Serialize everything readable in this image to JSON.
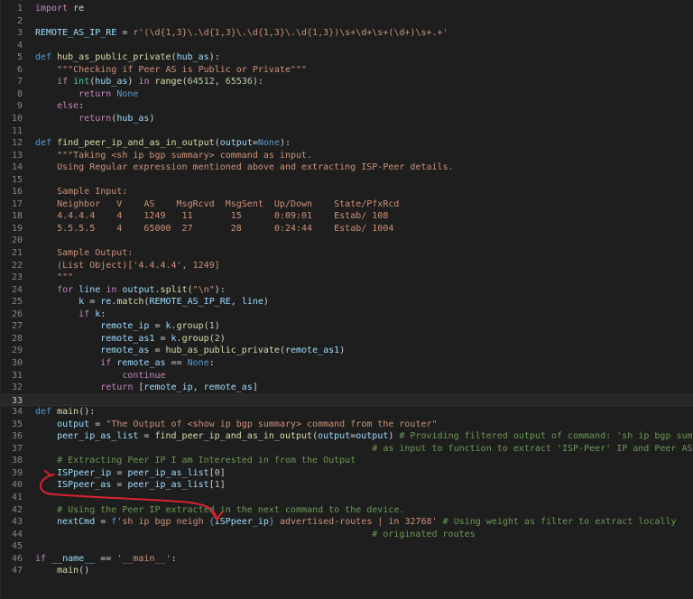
{
  "editor": {
    "lines": [
      {
        "n": "1",
        "t": [
          {
            "c": "kw",
            "s": "import"
          },
          {
            "c": "op",
            "s": " re"
          }
        ]
      },
      {
        "n": "2",
        "t": []
      },
      {
        "n": "3",
        "t": [
          {
            "c": "var",
            "s": "REMOTE_AS_IP_RE"
          },
          {
            "c": "op",
            "s": " = "
          },
          {
            "c": "str",
            "s": "r'(\\d{1,3}\\.\\d{1,3}\\.\\d{1,3}\\.\\d{1,3})\\s+\\d+\\s+(\\d+)\\s+.+'"
          }
        ]
      },
      {
        "n": "4",
        "t": []
      },
      {
        "n": "5",
        "t": [
          {
            "c": "def",
            "s": "def"
          },
          {
            "c": "op",
            "s": " "
          },
          {
            "c": "fn",
            "s": "hub_as_public_private"
          },
          {
            "c": "op",
            "s": "("
          },
          {
            "c": "var",
            "s": "hub_as"
          },
          {
            "c": "op",
            "s": "):"
          }
        ]
      },
      {
        "n": "6",
        "t": [
          {
            "c": "str",
            "s": "    \"\"\"Checking if Peer AS is Public or Private\"\"\""
          }
        ]
      },
      {
        "n": "7",
        "t": [
          {
            "c": "kw",
            "s": "    if"
          },
          {
            "c": "op",
            "s": " "
          },
          {
            "c": "bi",
            "s": "int"
          },
          {
            "c": "op",
            "s": "("
          },
          {
            "c": "var",
            "s": "hub_as"
          },
          {
            "c": "op",
            "s": ") "
          },
          {
            "c": "kw",
            "s": "in"
          },
          {
            "c": "op",
            "s": " "
          },
          {
            "c": "fn",
            "s": "range"
          },
          {
            "c": "op",
            "s": "("
          },
          {
            "c": "num",
            "s": "64512"
          },
          {
            "c": "op",
            "s": ", "
          },
          {
            "c": "num",
            "s": "65536"
          },
          {
            "c": "op",
            "s": "):"
          }
        ]
      },
      {
        "n": "8",
        "t": [
          {
            "c": "kw",
            "s": "        return"
          },
          {
            "c": "op",
            "s": " "
          },
          {
            "c": "const",
            "s": "None"
          }
        ]
      },
      {
        "n": "9",
        "t": [
          {
            "c": "kw",
            "s": "    else"
          },
          {
            "c": "op",
            "s": ":"
          }
        ]
      },
      {
        "n": "10",
        "t": [
          {
            "c": "kw",
            "s": "        return"
          },
          {
            "c": "op",
            "s": "("
          },
          {
            "c": "var",
            "s": "hub_as"
          },
          {
            "c": "op",
            "s": ")"
          }
        ]
      },
      {
        "n": "11",
        "t": []
      },
      {
        "n": "12",
        "t": [
          {
            "c": "def",
            "s": "def"
          },
          {
            "c": "op",
            "s": " "
          },
          {
            "c": "fn",
            "s": "find_peer_ip_and_as_in_output"
          },
          {
            "c": "op",
            "s": "("
          },
          {
            "c": "var",
            "s": "output"
          },
          {
            "c": "op",
            "s": "="
          },
          {
            "c": "const",
            "s": "None"
          },
          {
            "c": "op",
            "s": "):"
          }
        ]
      },
      {
        "n": "13",
        "t": [
          {
            "c": "str",
            "s": "    \"\"\"Taking <sh ip bgp summary> command as input."
          }
        ]
      },
      {
        "n": "14",
        "t": [
          {
            "c": "str",
            "s": "    Using Regular expression mentioned above and extracting ISP-Peer details."
          }
        ]
      },
      {
        "n": "15",
        "t": []
      },
      {
        "n": "16",
        "t": [
          {
            "c": "str",
            "s": "    Sample Input:"
          }
        ]
      },
      {
        "n": "17",
        "t": [
          {
            "c": "str",
            "s": "    Neighbor   V    AS    MsgRcvd  MsgSent  Up/Down    State/PfxRcd"
          }
        ]
      },
      {
        "n": "18",
        "t": [
          {
            "c": "str",
            "s": "    4.4.4.4    4    1249   11       15      0:09:01    Estab/ 108"
          }
        ]
      },
      {
        "n": "19",
        "t": [
          {
            "c": "str",
            "s": "    5.5.5.5    4    65000  27       28      0:24:44    Estab/ 1004"
          }
        ]
      },
      {
        "n": "20",
        "t": []
      },
      {
        "n": "21",
        "t": [
          {
            "c": "str",
            "s": "    Sample Output:"
          }
        ]
      },
      {
        "n": "22",
        "t": [
          {
            "c": "str",
            "s": "    (List Object)['4.4.4.4', 1249]"
          }
        ]
      },
      {
        "n": "23",
        "t": [
          {
            "c": "str",
            "s": "    \"\"\""
          }
        ]
      },
      {
        "n": "24",
        "t": [
          {
            "c": "kw",
            "s": "    for"
          },
          {
            "c": "op",
            "s": " "
          },
          {
            "c": "var",
            "s": "line"
          },
          {
            "c": "op",
            "s": " "
          },
          {
            "c": "kw",
            "s": "in"
          },
          {
            "c": "op",
            "s": " "
          },
          {
            "c": "var",
            "s": "output"
          },
          {
            "c": "op",
            "s": "."
          },
          {
            "c": "fn",
            "s": "split"
          },
          {
            "c": "op",
            "s": "("
          },
          {
            "c": "str",
            "s": "\"\\n\""
          },
          {
            "c": "op",
            "s": "):"
          }
        ]
      },
      {
        "n": "25",
        "t": [
          {
            "c": "var",
            "s": "        k"
          },
          {
            "c": "op",
            "s": " = "
          },
          {
            "c": "var",
            "s": "re"
          },
          {
            "c": "op",
            "s": "."
          },
          {
            "c": "fn",
            "s": "match"
          },
          {
            "c": "op",
            "s": "("
          },
          {
            "c": "var",
            "s": "REMOTE_AS_IP_RE"
          },
          {
            "c": "op",
            "s": ", "
          },
          {
            "c": "var",
            "s": "line"
          },
          {
            "c": "op",
            "s": ")"
          }
        ]
      },
      {
        "n": "26",
        "t": [
          {
            "c": "kw",
            "s": "        if"
          },
          {
            "c": "op",
            "s": " "
          },
          {
            "c": "var",
            "s": "k"
          },
          {
            "c": "op",
            "s": ":"
          }
        ]
      },
      {
        "n": "27",
        "t": [
          {
            "c": "var",
            "s": "            remote_ip"
          },
          {
            "c": "op",
            "s": " = "
          },
          {
            "c": "var",
            "s": "k"
          },
          {
            "c": "op",
            "s": "."
          },
          {
            "c": "fn",
            "s": "group"
          },
          {
            "c": "op",
            "s": "("
          },
          {
            "c": "num",
            "s": "1"
          },
          {
            "c": "op",
            "s": ")"
          }
        ]
      },
      {
        "n": "28",
        "t": [
          {
            "c": "var",
            "s": "            remote_as1"
          },
          {
            "c": "op",
            "s": " = "
          },
          {
            "c": "var",
            "s": "k"
          },
          {
            "c": "op",
            "s": "."
          },
          {
            "c": "fn",
            "s": "group"
          },
          {
            "c": "op",
            "s": "("
          },
          {
            "c": "num",
            "s": "2"
          },
          {
            "c": "op",
            "s": ")"
          }
        ]
      },
      {
        "n": "29",
        "t": [
          {
            "c": "var",
            "s": "            remote_as"
          },
          {
            "c": "op",
            "s": " = "
          },
          {
            "c": "fn",
            "s": "hub_as_public_private"
          },
          {
            "c": "op",
            "s": "("
          },
          {
            "c": "var",
            "s": "remote_as1"
          },
          {
            "c": "op",
            "s": ")"
          }
        ]
      },
      {
        "n": "30",
        "t": [
          {
            "c": "kw",
            "s": "            if"
          },
          {
            "c": "op",
            "s": " "
          },
          {
            "c": "var",
            "s": "remote_as"
          },
          {
            "c": "op",
            "s": " == "
          },
          {
            "c": "const",
            "s": "None"
          },
          {
            "c": "op",
            "s": ":"
          }
        ]
      },
      {
        "n": "31",
        "t": [
          {
            "c": "kw",
            "s": "                continue"
          }
        ]
      },
      {
        "n": "32",
        "t": [
          {
            "c": "kw",
            "s": "            return"
          },
          {
            "c": "op",
            "s": " ["
          },
          {
            "c": "var",
            "s": "remote_ip"
          },
          {
            "c": "op",
            "s": ", "
          },
          {
            "c": "var",
            "s": "remote_as"
          },
          {
            "c": "op",
            "s": "]"
          }
        ]
      },
      {
        "n": "33",
        "t": [],
        "current": true
      },
      {
        "n": "34",
        "t": [
          {
            "c": "def",
            "s": "def"
          },
          {
            "c": "op",
            "s": " "
          },
          {
            "c": "fn",
            "s": "main"
          },
          {
            "c": "op",
            "s": "():"
          }
        ]
      },
      {
        "n": "35",
        "t": [
          {
            "c": "var",
            "s": "    output"
          },
          {
            "c": "op",
            "s": " = "
          },
          {
            "c": "str",
            "s": "\"The Output of <show ip bgp summary> command from the router\""
          }
        ]
      },
      {
        "n": "36",
        "t": [
          {
            "c": "var",
            "s": "    peer_ip_as_list"
          },
          {
            "c": "op",
            "s": " = "
          },
          {
            "c": "fn",
            "s": "find_peer_ip_and_as_in_output"
          },
          {
            "c": "op",
            "s": "("
          },
          {
            "c": "var",
            "s": "output"
          },
          {
            "c": "op",
            "s": "="
          },
          {
            "c": "var",
            "s": "output"
          },
          {
            "c": "op",
            "s": ") "
          },
          {
            "c": "com",
            "s": "# Providing filtered output of command: 'sh ip bgp summ'"
          }
        ]
      },
      {
        "n": "37",
        "t": [
          {
            "c": "com",
            "s": "                                                              # as input to function to extract 'ISP-Peer' IP and Peer AS"
          }
        ]
      },
      {
        "n": "38",
        "t": [
          {
            "c": "com",
            "s": "    # Extracting Peer IP I am Interested in from the Output"
          }
        ]
      },
      {
        "n": "39",
        "t": [
          {
            "c": "var",
            "s": "    ISPpeer_ip"
          },
          {
            "c": "op",
            "s": " = "
          },
          {
            "c": "var",
            "s": "peer_ip_as_list"
          },
          {
            "c": "op",
            "s": "["
          },
          {
            "c": "num",
            "s": "0"
          },
          {
            "c": "op",
            "s": "]"
          }
        ]
      },
      {
        "n": "40",
        "t": [
          {
            "c": "var",
            "s": "    ISPpeer_as"
          },
          {
            "c": "op",
            "s": " = "
          },
          {
            "c": "var",
            "s": "peer_ip_as_list"
          },
          {
            "c": "op",
            "s": "["
          },
          {
            "c": "num",
            "s": "1"
          },
          {
            "c": "op",
            "s": "]"
          }
        ]
      },
      {
        "n": "41",
        "t": []
      },
      {
        "n": "42",
        "t": [
          {
            "c": "com",
            "s": "    # Using the Peer IP extracted in the next command to the device."
          }
        ]
      },
      {
        "n": "43",
        "t": [
          {
            "c": "var",
            "s": "    nextCmd"
          },
          {
            "c": "op",
            "s": " = "
          },
          {
            "c": "fst",
            "s": "f"
          },
          {
            "c": "str",
            "s": "'sh ip bgp neigh "
          },
          {
            "c": "fst",
            "s": "{"
          },
          {
            "c": "var",
            "s": "ISPpeer_ip"
          },
          {
            "c": "fst",
            "s": "}"
          },
          {
            "c": "str",
            "s": " advertised-routes | in 32768'"
          },
          {
            "c": "op",
            "s": " "
          },
          {
            "c": "com",
            "s": "# Using weight as filter to extract locally"
          }
        ]
      },
      {
        "n": "44",
        "t": [
          {
            "c": "com",
            "s": "                                                              # originated routes"
          }
        ]
      },
      {
        "n": "45",
        "t": []
      },
      {
        "n": "46",
        "t": [
          {
            "c": "kw",
            "s": "if"
          },
          {
            "c": "op",
            "s": " "
          },
          {
            "c": "var",
            "s": "__name__"
          },
          {
            "c": "op",
            "s": " == "
          },
          {
            "c": "str",
            "s": "'__main__'"
          },
          {
            "c": "op",
            "s": ":"
          }
        ]
      },
      {
        "n": "47",
        "t": [
          {
            "c": "fn",
            "s": "    main"
          },
          {
            "c": "op",
            "s": "()"
          }
        ]
      }
    ]
  },
  "annotation": {
    "color": "#d9232d"
  }
}
